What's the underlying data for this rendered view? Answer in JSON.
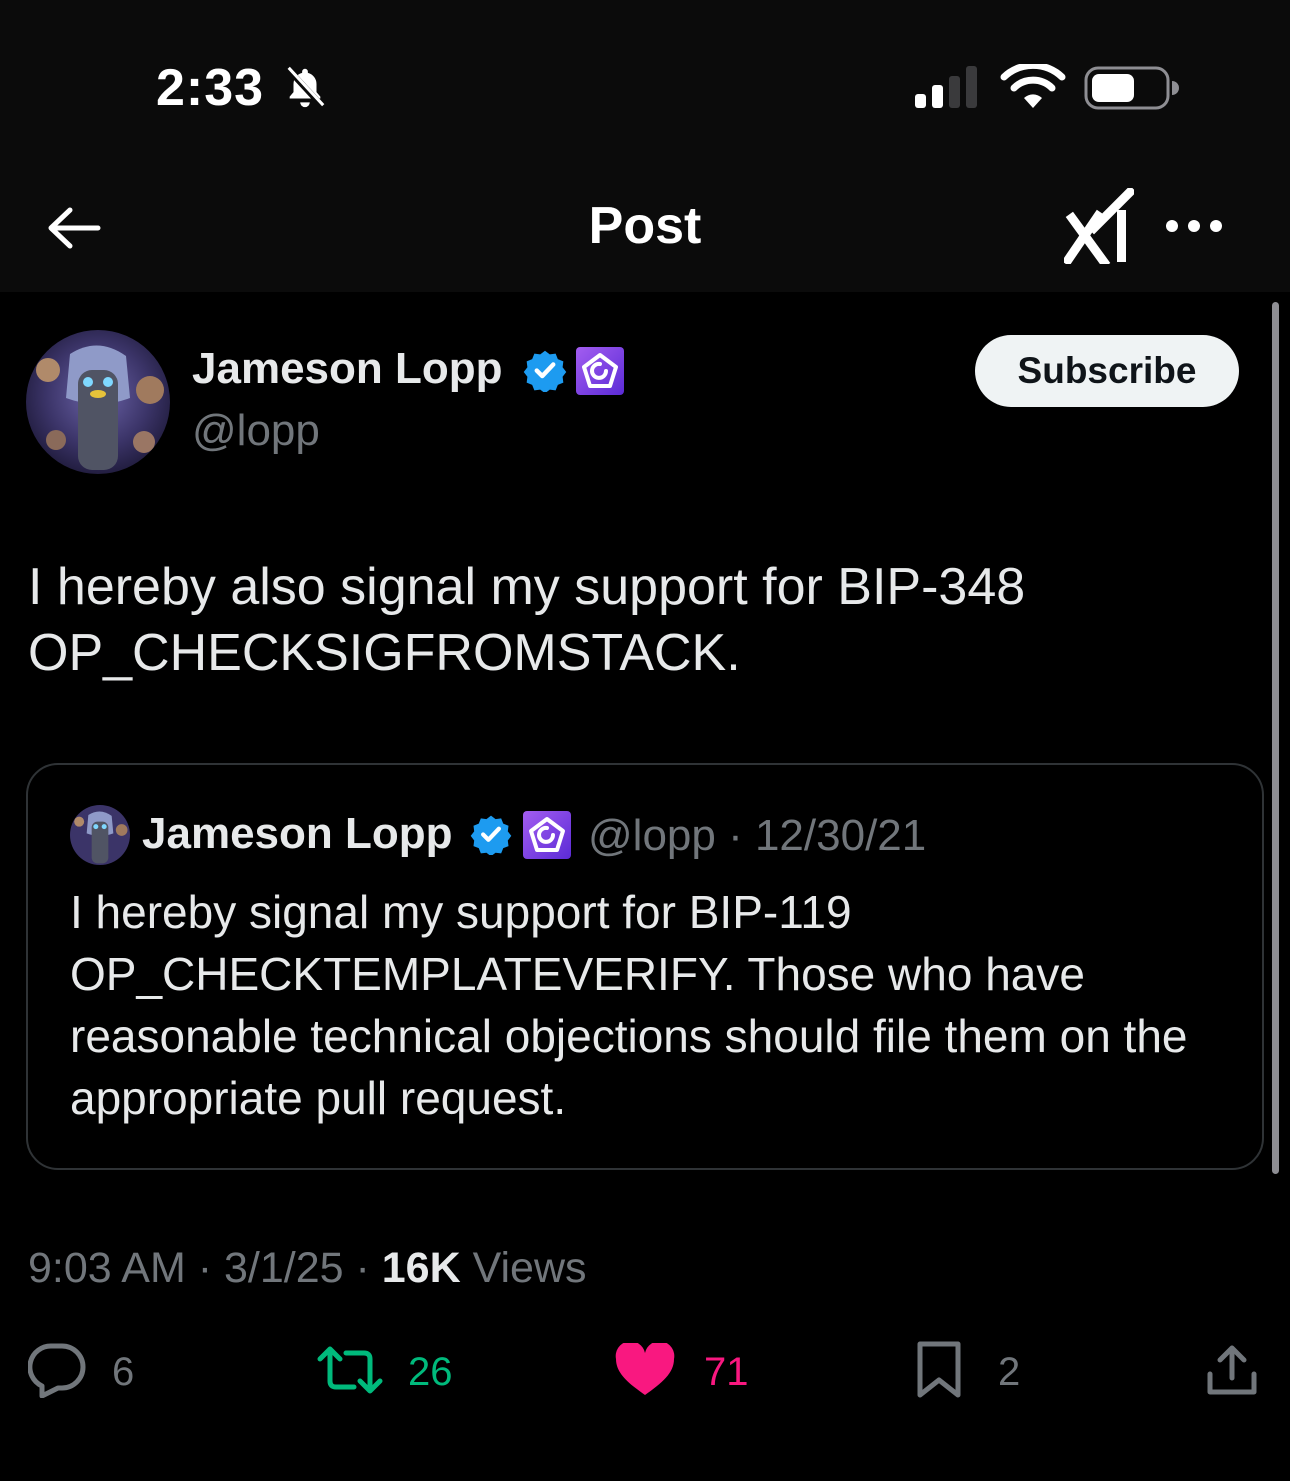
{
  "status_bar": {
    "time": "2:33",
    "icons": [
      "bell-off-icon",
      "cellular-signal-icon",
      "wifi-icon",
      "battery-icon"
    ]
  },
  "nav": {
    "title": "Post",
    "icons": [
      "back-arrow-icon",
      "grok-icon",
      "more-icon"
    ]
  },
  "post": {
    "author": {
      "name": "Jameson Lopp",
      "handle": "@lopp",
      "verified": true,
      "affiliate_badge_icon": "organization-badge-icon"
    },
    "subscribe_label": "Subscribe",
    "text": "I hereby also signal my support for BIP-348 OP_CHECKSIGFROMSTACK.",
    "quoted": {
      "author_name": "Jameson Lopp",
      "handle_date": "@lopp · 12/30/21",
      "text": "I hereby signal my support for BIP-119 OP_CHECKTEMPLATEVERIFY. Those who have reasonable technical objections should file them on the appropriate pull request."
    },
    "meta": {
      "time_date": "9:03 AM · 3/1/25 · ",
      "views_count": "16K",
      "views_label": " Views"
    },
    "actions": {
      "replies": "6",
      "reposts": "26",
      "likes": "71",
      "bookmarks": "2"
    }
  },
  "colors": {
    "background": "#000000",
    "header_background": "#0b0b0b",
    "text_primary": "#e7e9ea",
    "text_secondary": "#71767b",
    "verified_blue": "#1d9bf0",
    "repost_green": "#00ba7c",
    "like_pink": "#f91880",
    "badge_purple": "#7b3fe4"
  }
}
